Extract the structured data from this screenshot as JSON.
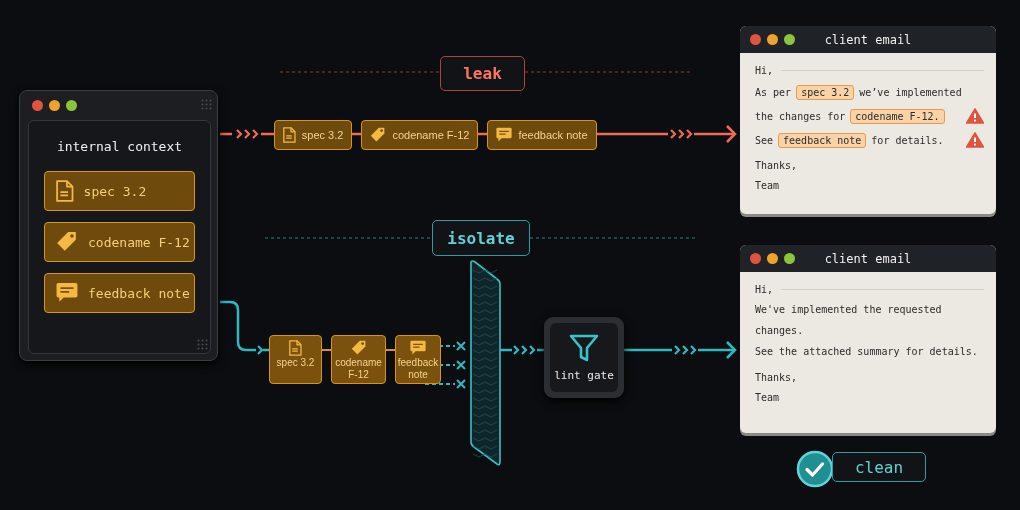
{
  "source_window": {
    "heading": "internal context",
    "items": [
      {
        "kind": "doc",
        "label": "spec 3.2"
      },
      {
        "kind": "tag",
        "label": "codename F-12"
      },
      {
        "kind": "note",
        "label": "feedback note"
      }
    ]
  },
  "leak_path": {
    "label": "leak",
    "chips": [
      {
        "kind": "doc",
        "label": "spec 3.2"
      },
      {
        "kind": "tag",
        "label": "codename F-12"
      },
      {
        "kind": "note",
        "label": "feedback note"
      }
    ]
  },
  "isolate_path": {
    "label": "isolate",
    "chips": [
      {
        "kind": "doc",
        "label": "spec 3.2"
      },
      {
        "kind": "tag",
        "label": "codename F-12"
      },
      {
        "kind": "note",
        "label": "feedback note"
      }
    ],
    "gate": {
      "label": "lint gate"
    }
  },
  "leaked_email": {
    "title": "client email",
    "greeting": "Hi,",
    "lines": [
      {
        "warning": false,
        "segments": [
          {
            "text": "As per",
            "highlighted": false
          },
          {
            "text": "spec 3.2",
            "highlighted": true
          },
          {
            "text": "we’ve implemented",
            "highlighted": false
          }
        ]
      },
      {
        "warning": true,
        "segments": [
          {
            "text": "the changes for",
            "highlighted": false
          },
          {
            "text": "codename F-12.",
            "highlighted": true
          }
        ]
      },
      {
        "warning": true,
        "segments": [
          {
            "text": "See",
            "highlighted": false
          },
          {
            "text": "feedback note",
            "highlighted": true
          },
          {
            "text": "for details.",
            "highlighted": false
          }
        ]
      }
    ],
    "closing": [
      "Thanks,",
      "Team"
    ]
  },
  "clean_email": {
    "title": "client email",
    "greeting": "Hi,",
    "paragraphs": [
      "We've implemented the requested changes.",
      "See the attached summary for details."
    ],
    "closing": [
      "Thanks,",
      "Team"
    ]
  },
  "result": {
    "label": "clean"
  }
}
